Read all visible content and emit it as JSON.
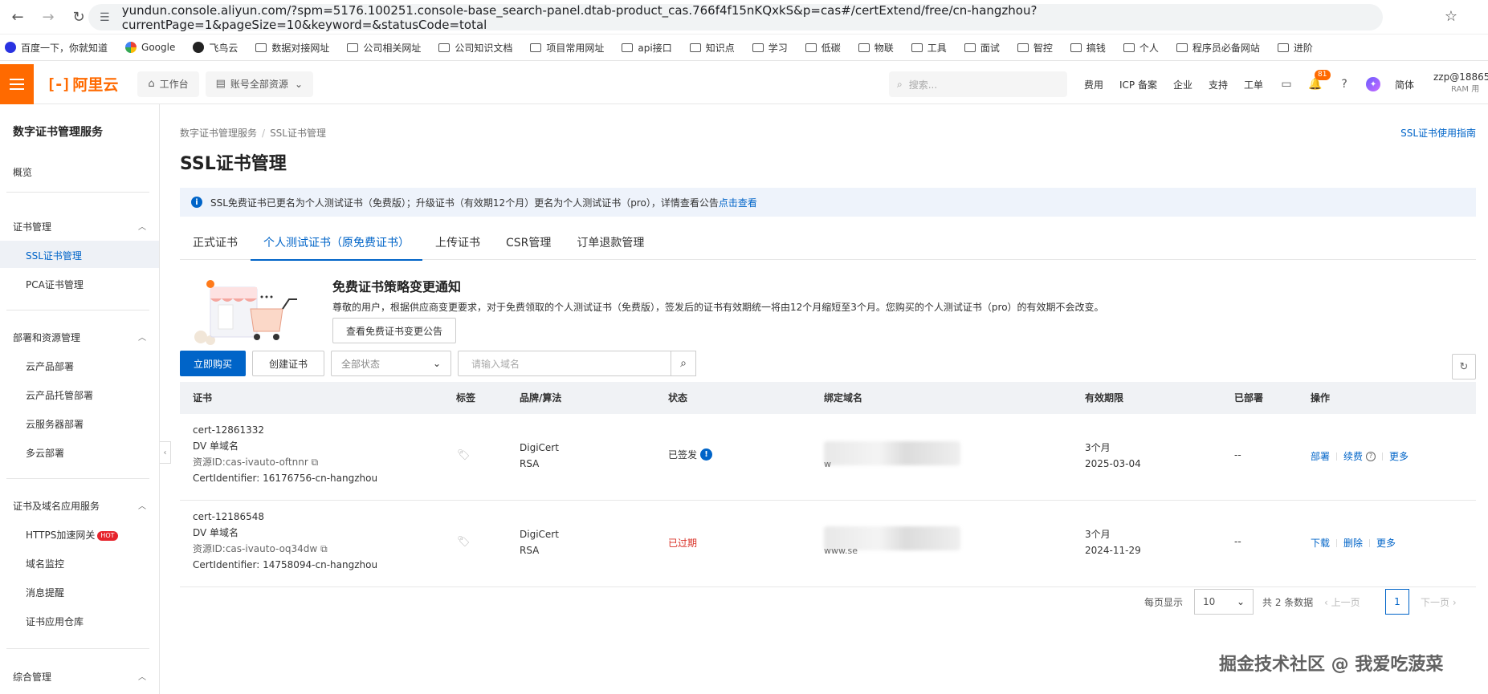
{
  "browser": {
    "url": "yundun.console.aliyun.com/?spm=5176.100251.console-base_search-panel.dtab-product_cas.766f4f15nKQxkS&p=cas#/certExtend/free/cn-hangzhou?currentPage=1&pageSize=10&keyword=&statusCode=total",
    "bookmarks": [
      "百度一下，你就知道",
      "Google",
      "飞鸟云",
      "数据对接网址",
      "公司相关网址",
      "公司知识文档",
      "项目常用网址",
      "api接口",
      "知识点",
      "学习",
      "低碳",
      "物联",
      "工具",
      "面试",
      "智控",
      "搞钱",
      "个人",
      "程序员必备网站",
      "进阶"
    ]
  },
  "header": {
    "logo": "阿里云",
    "workbench": "工作台",
    "resources": "账号全部资源",
    "search_placeholder": "搜索...",
    "links": [
      "费用",
      "ICP 备案",
      "企业",
      "支持",
      "工单"
    ],
    "notification_count": "81",
    "lang": "简体",
    "user": "zzp@18865...",
    "user_sub": "RAM 用"
  },
  "sidebar": {
    "title": "数字证书管理服务",
    "overview": "概览",
    "groups": [
      {
        "label": "证书管理",
        "items": [
          "SSL证书管理",
          "PCA证书管理"
        ]
      },
      {
        "label": "部署和资源管理",
        "items": [
          "云产品部署",
          "云产品托管部署",
          "云服务器部署",
          "多云部署"
        ]
      },
      {
        "label": "证书及域名应用服务",
        "items": [
          "HTTPS加速网关",
          "域名监控",
          "消息提醒",
          "证书应用仓库"
        ]
      },
      {
        "label": "综合管理",
        "items": []
      }
    ],
    "hot_badge": "HOT"
  },
  "main": {
    "breadcrumb": [
      "数字证书管理服务",
      "SSL证书管理"
    ],
    "guide_link": "SSL证书使用指南",
    "title": "SSL证书管理",
    "notice_text": "SSL免费证书已更名为个人测试证书（免费版）；升级证书（有效期12个月）更名为个人测试证书（pro），详情查看公告",
    "notice_link": "点击查看",
    "tabs": [
      "正式证书",
      "个人测试证书（原免费证书）",
      "上传证书",
      "CSR管理",
      "订单退款管理"
    ],
    "promo": {
      "title": "免费证书策略变更通知",
      "text": "尊敬的用户，根据供应商变更要求，对于免费领取的个人测试证书（免费版），签发后的证书有效期统一将由12个月缩短至3个月。您购买的个人测试证书（pro）的有效期不会改变。",
      "button": "查看免费证书变更公告"
    },
    "toolbar": {
      "buy": "立即购买",
      "create": "创建证书",
      "status_select": "全部状态",
      "domain_placeholder": "请输入域名"
    },
    "table": {
      "headers": [
        "证书",
        "标签",
        "品牌/算法",
        "状态",
        "绑定域名",
        "有效期限",
        "已部署",
        "操作"
      ],
      "rows": [
        {
          "cert_id": "cert-12861332",
          "type": "DV 单域名",
          "resource": "资源ID:cas-ivauto-oftnnr",
          "identifier": "CertIdentifier: 16176756-cn-hangzhou",
          "brand": "DigiCert",
          "algo": "RSA",
          "status": "已签发",
          "domain_hint": "w",
          "validity": "3个月",
          "expiry": "2025-03-04",
          "deployed": "--",
          "ops": [
            "部署",
            "续费",
            "更多"
          ]
        },
        {
          "cert_id": "cert-12186548",
          "type": "DV 单域名",
          "resource": "资源ID:cas-ivauto-oq34dw",
          "identifier": "CertIdentifier: 14758094-cn-hangzhou",
          "brand": "DigiCert",
          "algo": "RSA",
          "status": "已过期",
          "domain_hint": "www.se",
          "validity": "3个月",
          "expiry": "2024-11-29",
          "deployed": "--",
          "ops": [
            "下载",
            "删除",
            "更多"
          ]
        }
      ]
    },
    "pager": {
      "per_page_label": "每页显示",
      "per_page": "10",
      "total": "共 2 条数据",
      "prev": "上一页",
      "current": "1",
      "next": "下一页"
    }
  },
  "watermark": "掘金技术社区 @ 我爱吃菠菜"
}
